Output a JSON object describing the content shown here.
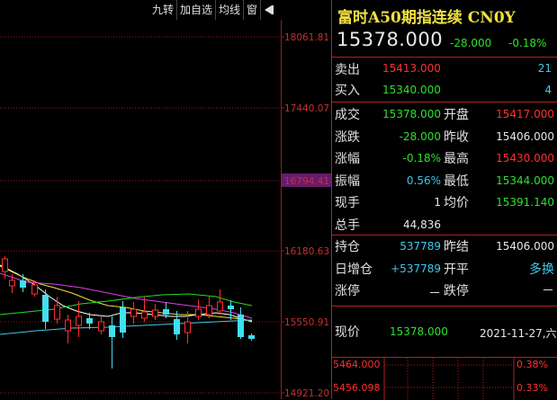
{
  "toolbar": {
    "items": [
      "九转",
      "加自选",
      "均线",
      "窗"
    ],
    "collapse_icon": "collapse-left-icon"
  },
  "chart": {
    "price_labels": [
      "18061.81",
      "17440.07",
      "16794.41",
      "16180.63",
      "15550.91",
      "14921.20"
    ],
    "crosshair_price": "16794.41",
    "colors": {
      "up": "#ff3030",
      "down": "#40e0f0",
      "grid": "#a01818",
      "ma5": "#ffffff",
      "ma10": "#f0e040",
      "ma20": "#e040e0",
      "ma60": "#20e020"
    }
  },
  "quote": {
    "title": "富时A50期指连续 CN0Y",
    "price": "15378.000",
    "change": "-28.000",
    "change_pct": "-0.18%",
    "sell_label": "卖出",
    "sell_price": "15413.000",
    "sell_vol": "21",
    "buy_label": "买入",
    "buy_price": "15340.000",
    "buy_vol": "4",
    "rows": [
      {
        "l1": "成交",
        "v1": "15378.000",
        "l2": "开盘",
        "v2": "15417.000"
      },
      {
        "l1": "涨跌",
        "v1": "-28.000",
        "l2": "昨收",
        "v2": "15406.000"
      },
      {
        "l1": "涨幅",
        "v1": "-0.18%",
        "l2": "最高",
        "v2": "15430.000"
      },
      {
        "l1": "振幅",
        "v1": "0.56%",
        "l2": "最低",
        "v2": "15344.000"
      },
      {
        "l1": "现手",
        "v1": "1",
        "l2": "均价",
        "v2": "15391.140"
      },
      {
        "l1": "总手",
        "v1": "44,836",
        "l2": "",
        "v2": ""
      }
    ],
    "rows2": [
      {
        "l1": "持仓",
        "v1": "537789",
        "l2": "昨结",
        "v2": "15406.000"
      },
      {
        "l1": "日增仓",
        "v1": "+537789",
        "l2": "开平",
        "v2": "多换"
      },
      {
        "l1": "涨停",
        "v1": "－",
        "l2": "跌停",
        "v2": "－"
      }
    ],
    "last_label": "现价",
    "last_price": "15378.000",
    "last_date": "2021-11-27,六"
  },
  "mini": {
    "prices": [
      "5464.000",
      "5456.098"
    ],
    "pcts": [
      "0.38%",
      "0.33%"
    ]
  }
}
